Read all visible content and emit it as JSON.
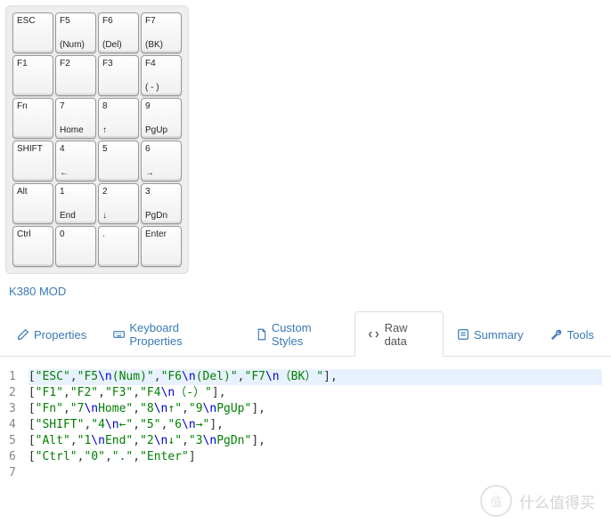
{
  "layout_name": "K380 MOD",
  "keys": [
    [
      {
        "top": "ESC",
        "bot": ""
      },
      {
        "top": "F5",
        "bot": "(Num)"
      },
      {
        "top": "F6",
        "bot": "(Del)"
      },
      {
        "top": "F7",
        "bot": "(BK)"
      }
    ],
    [
      {
        "top": "F1",
        "bot": ""
      },
      {
        "top": "F2",
        "bot": ""
      },
      {
        "top": "F3",
        "bot": ""
      },
      {
        "top": "F4",
        "bot": "( - )"
      }
    ],
    [
      {
        "top": "Fn",
        "bot": ""
      },
      {
        "top": "7",
        "bot": "Home"
      },
      {
        "top": "8",
        "bot": "↑"
      },
      {
        "top": "9",
        "bot": "PgUp"
      }
    ],
    [
      {
        "top": "SHIFT",
        "bot": ""
      },
      {
        "top": "4",
        "bot": "←"
      },
      {
        "top": "5",
        "bot": ""
      },
      {
        "top": "6",
        "bot": "→"
      }
    ],
    [
      {
        "top": "Alt",
        "bot": ""
      },
      {
        "top": "1",
        "bot": "End"
      },
      {
        "top": "2",
        "bot": "↓"
      },
      {
        "top": "3",
        "bot": "PgDn"
      }
    ],
    [
      {
        "top": "Ctrl",
        "bot": ""
      },
      {
        "top": "0",
        "bot": ""
      },
      {
        "top": ".",
        "bot": ""
      },
      {
        "top": "Enter",
        "bot": ""
      }
    ]
  ],
  "tabs": {
    "properties": "Properties",
    "keyboard_properties": "Keyboard Properties",
    "custom_styles": "Custom Styles",
    "raw_data": "Raw data",
    "summary": "Summary",
    "tools": "Tools"
  },
  "raw_lines": [
    {
      "n": "1",
      "seg": [
        [
          "p",
          "["
        ],
        [
          "g",
          "\"ESC\""
        ],
        [
          "p",
          ","
        ],
        [
          "g",
          "\"F5"
        ],
        [
          "b",
          "\\n"
        ],
        [
          "g",
          "(Num)\""
        ],
        [
          "p",
          ","
        ],
        [
          "g",
          "\"F6"
        ],
        [
          "b",
          "\\n"
        ],
        [
          "g",
          "(Del)\""
        ],
        [
          "p",
          ","
        ],
        [
          "g",
          "\"F7"
        ],
        [
          "b",
          "\\n"
        ],
        [
          "g",
          "（BK）\""
        ],
        [
          "p",
          "],"
        ]
      ]
    },
    {
      "n": "2",
      "seg": [
        [
          "p",
          "["
        ],
        [
          "g",
          "\"F1\""
        ],
        [
          "p",
          ","
        ],
        [
          "g",
          "\"F2\""
        ],
        [
          "p",
          ","
        ],
        [
          "g",
          "\"F3\""
        ],
        [
          "p",
          ","
        ],
        [
          "g",
          "\"F4"
        ],
        [
          "b",
          "\\n"
        ],
        [
          "g",
          "（-）\""
        ],
        [
          "p",
          "],"
        ]
      ]
    },
    {
      "n": "3",
      "seg": [
        [
          "p",
          "["
        ],
        [
          "g",
          "\"Fn\""
        ],
        [
          "p",
          ","
        ],
        [
          "g",
          "\"7"
        ],
        [
          "b",
          "\\n"
        ],
        [
          "g",
          "Home\""
        ],
        [
          "p",
          ","
        ],
        [
          "g",
          "\"8"
        ],
        [
          "b",
          "\\n"
        ],
        [
          "g",
          "↑\""
        ],
        [
          "p",
          ","
        ],
        [
          "g",
          "\"9"
        ],
        [
          "b",
          "\\n"
        ],
        [
          "g",
          "PgUp\""
        ],
        [
          "p",
          "],"
        ]
      ]
    },
    {
      "n": "4",
      "seg": [
        [
          "p",
          "["
        ],
        [
          "g",
          "\"SHIFT\""
        ],
        [
          "p",
          ","
        ],
        [
          "g",
          "\"4"
        ],
        [
          "b",
          "\\n"
        ],
        [
          "g",
          "←\""
        ],
        [
          "p",
          ","
        ],
        [
          "g",
          "\"5\""
        ],
        [
          "p",
          ","
        ],
        [
          "g",
          "\"6"
        ],
        [
          "b",
          "\\n"
        ],
        [
          "g",
          "→\""
        ],
        [
          "p",
          "],"
        ]
      ]
    },
    {
      "n": "5",
      "seg": [
        [
          "p",
          "["
        ],
        [
          "g",
          "\"Alt\""
        ],
        [
          "p",
          ","
        ],
        [
          "g",
          "\"1"
        ],
        [
          "b",
          "\\n"
        ],
        [
          "g",
          "End\""
        ],
        [
          "p",
          ","
        ],
        [
          "g",
          "\"2"
        ],
        [
          "b",
          "\\n"
        ],
        [
          "g",
          "↓\""
        ],
        [
          "p",
          ","
        ],
        [
          "g",
          "\"3"
        ],
        [
          "b",
          "\\n"
        ],
        [
          "g",
          "PgDn\""
        ],
        [
          "p",
          "],"
        ]
      ]
    },
    {
      "n": "6",
      "seg": [
        [
          "p",
          "["
        ],
        [
          "g",
          "\"Ctrl\""
        ],
        [
          "p",
          ","
        ],
        [
          "g",
          "\"0\""
        ],
        [
          "p",
          ","
        ],
        [
          "g",
          "\".\""
        ],
        [
          "p",
          ","
        ],
        [
          "g",
          "\"Enter\""
        ],
        [
          "p",
          "]"
        ]
      ]
    },
    {
      "n": "7",
      "seg": []
    }
  ],
  "watermark": {
    "inner": "值",
    "text": "什么值得买"
  }
}
